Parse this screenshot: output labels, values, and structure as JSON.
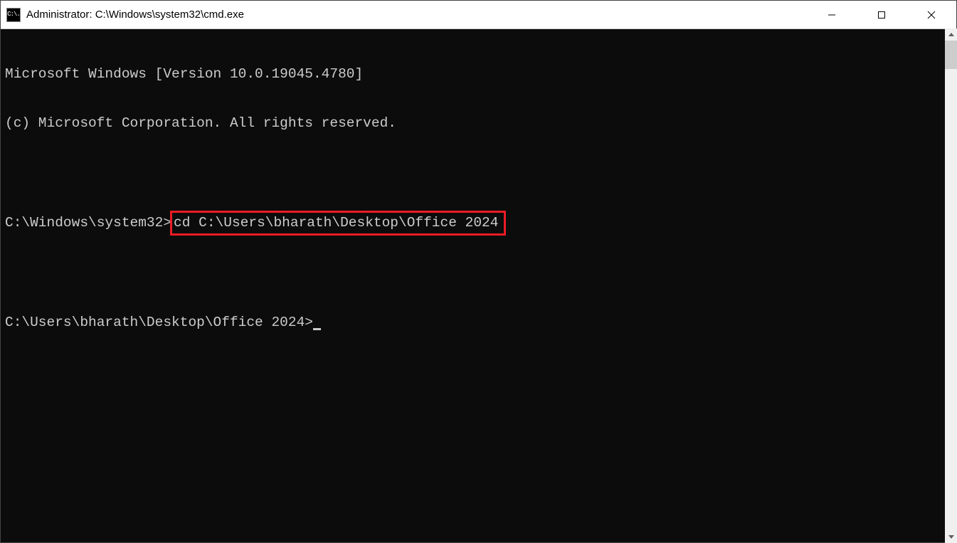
{
  "titlebar": {
    "icon_label": "C:\\.",
    "title": "Administrator: C:\\Windows\\system32\\cmd.exe"
  },
  "terminal": {
    "line1": "Microsoft Windows [Version 10.0.19045.4780]",
    "line2": "(c) Microsoft Corporation. All rights reserved.",
    "prompt1_prefix": "C:\\Windows\\system32>",
    "prompt1_command": "cd C:\\Users\\bharath\\Desktop\\Office 2024",
    "prompt2": "C:\\Users\\bharath\\Desktop\\Office 2024>"
  }
}
